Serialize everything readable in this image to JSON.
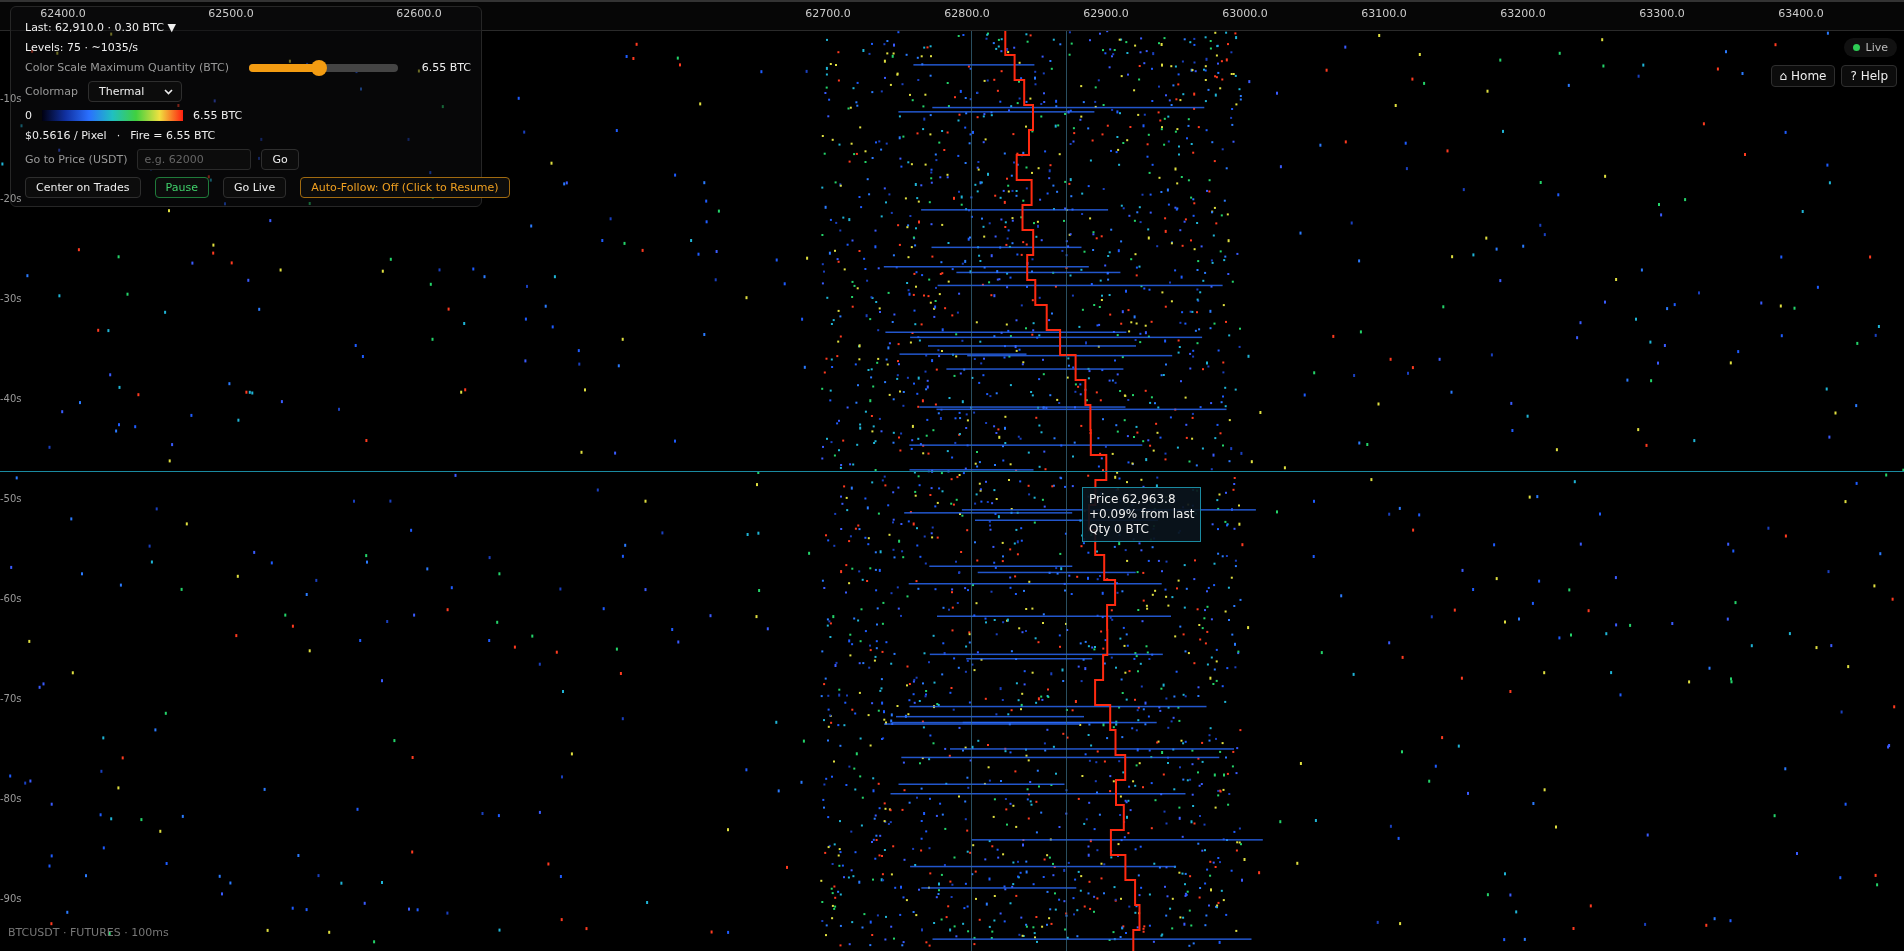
{
  "axis": {
    "price_ticks": [
      "62400.0",
      "62500.0",
      "62600.0",
      "62700.0",
      "62800.0",
      "62900.0",
      "63000.0",
      "63100.0",
      "63200.0",
      "63300.0",
      "63400.0"
    ],
    "time_ticks": [
      "-10s",
      "-20s",
      "-30s",
      "-40s",
      "-50s",
      "-60s",
      "-70s",
      "-80s",
      "-90s"
    ]
  },
  "panel": {
    "last": "Last: 62,910.0 · 0.30 BTC ▼",
    "levels": "Levels: 75 · ~1035/s",
    "color_scale": {
      "label": "Color Scale Maximum Quantity (BTC)",
      "level": 0.47,
      "reading": "6.55 BTC"
    },
    "colormap": {
      "label": "Colormap",
      "value": "Thermal"
    },
    "legend": {
      "min": "0",
      "max": "6.55 BTC"
    },
    "info": {
      "pixel": "$0.5616 / Pixel",
      "separator": "·",
      "fire": "Fire = 6.55 BTC"
    },
    "goto": {
      "label": "Go to Price (USDT)",
      "placeholder": "e.g. 62000",
      "button": "Go"
    },
    "buttons": [
      {
        "label": "Center on Trades",
        "kind": "default"
      },
      {
        "label": "Pause",
        "kind": "success"
      },
      {
        "label": "Go Live",
        "kind": "default"
      },
      {
        "label": "Auto-Follow: Off (Click to Resume)",
        "kind": "warning"
      }
    ]
  },
  "status": {
    "label": "Live",
    "live": true
  },
  "nav": [
    {
      "label": "⌂ Home"
    },
    {
      "label": "? Help"
    }
  ],
  "tooltip": {
    "lines": [
      "Price 62,963.8",
      "+0.09% from last",
      "Qty 0 BTC"
    ]
  },
  "footer": "BTCUSDT · FUTURES · 100ms"
}
